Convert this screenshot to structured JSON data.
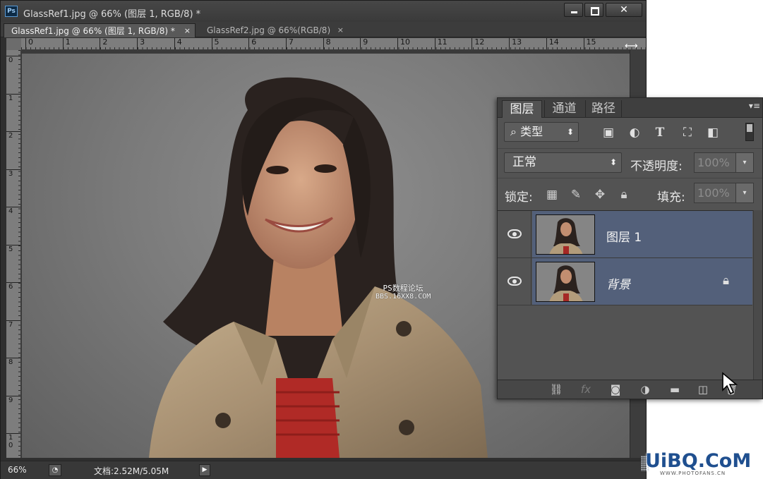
{
  "window": {
    "app_icon": "Ps",
    "title": "GlassRef1.jpg @ 66% (图层 1, RGB/8) *",
    "min_glyph": "",
    "max_glyph": "",
    "close_glyph": "✕"
  },
  "tabs": [
    {
      "label": "GlassRef1.jpg @ 66% (图层 1, RGB/8) *",
      "close": "×",
      "active": true
    },
    {
      "label": "GlassRef2.jpg @ 66%(RGB/8)",
      "close": "×",
      "active": false
    }
  ],
  "rulers": {
    "horizontal": [
      "0",
      "1",
      "2",
      "3",
      "4",
      "5",
      "6",
      "7",
      "8",
      "9",
      "10",
      "11",
      "12",
      "13",
      "14",
      "15"
    ],
    "vertical": [
      "0",
      "1",
      "2",
      "3",
      "4",
      "5",
      "6",
      "7",
      "8",
      "9",
      "1\n0"
    ]
  },
  "canvas": {
    "overlay_line1": "PS数程论坛",
    "overlay_line2": "BBS.16XX8.COM"
  },
  "status": {
    "zoom": "66%",
    "doc_info": "文档:2.52M/5.05M",
    "arrow": "▶"
  },
  "layers_panel": {
    "tabs": [
      "图层",
      "通道",
      "路径"
    ],
    "menu_icon": "▾≡",
    "filter": {
      "kind_label": "类型",
      "search_glyph": "⌕",
      "arrow": "⬍"
    },
    "filter_icons": [
      "image-filter-icon",
      "adjustment-filter-icon",
      "type-filter-icon",
      "shape-filter-icon",
      "smart-object-filter-icon"
    ],
    "blend_mode": "正常",
    "opacity_label": "不透明度:",
    "opacity_value": "100%",
    "lock_label": "锁定:",
    "fill_label": "填充:",
    "fill_value": "100%",
    "dropdown_arrow": "▾",
    "layers": [
      {
        "name": "图层 1",
        "italic": false,
        "locked": false
      },
      {
        "name": "背景",
        "italic": true,
        "locked": true
      }
    ],
    "footer_icons": [
      "link-layers-icon",
      "fx-icon",
      "add-mask-icon",
      "new-adjustment-icon",
      "new-group-icon",
      "new-layer-icon",
      "delete-layer-icon"
    ]
  },
  "watermark": {
    "main": "UiBQ.CoM",
    "sub": "WWW.PHOTOFANS.CN"
  },
  "colors": {
    "panel_bg": "#535353",
    "selected_layer": "#53607a",
    "window_bg": "#2f2f2f"
  }
}
